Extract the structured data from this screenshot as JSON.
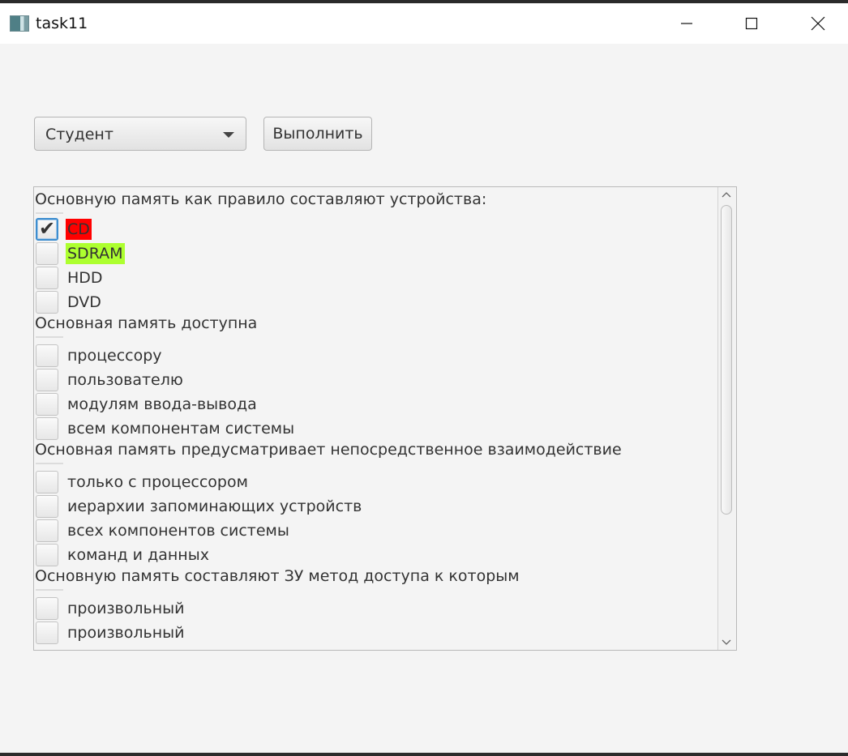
{
  "window": {
    "title": "task11"
  },
  "controls": {
    "role_select": "Студент",
    "run_button": "Выполнить"
  },
  "questions": [
    {
      "text": "Основную память как правило составляют устройства:",
      "options": [
        {
          "label": "CD",
          "checked": true,
          "highlight": "#ff0000"
        },
        {
          "label": "SDRAM",
          "checked": false,
          "highlight": "#adff2f"
        },
        {
          "label": "HDD",
          "checked": false
        },
        {
          "label": "DVD",
          "checked": false
        }
      ]
    },
    {
      "text": "Основная память доступна",
      "options": [
        {
          "label": "процессору",
          "checked": false
        },
        {
          "label": "пользователю",
          "checked": false
        },
        {
          "label": "модулям ввода-вывода",
          "checked": false
        },
        {
          "label": "всем компонентам системы",
          "checked": false
        }
      ]
    },
    {
      "text": "Основная память предусматривает непосредственное взаимодействие",
      "options": [
        {
          "label": "только с процессором",
          "checked": false
        },
        {
          "label": "иерархии запоминающих устройств",
          "checked": false
        },
        {
          "label": "всех компонентов системы",
          "checked": false
        },
        {
          "label": "команд и данных",
          "checked": false
        }
      ]
    },
    {
      "text": "Основную память составляют ЗУ метод доступа к которым",
      "options": [
        {
          "label": "произвольный",
          "checked": false
        },
        {
          "label": "произвольный",
          "checked": false
        }
      ]
    }
  ]
}
